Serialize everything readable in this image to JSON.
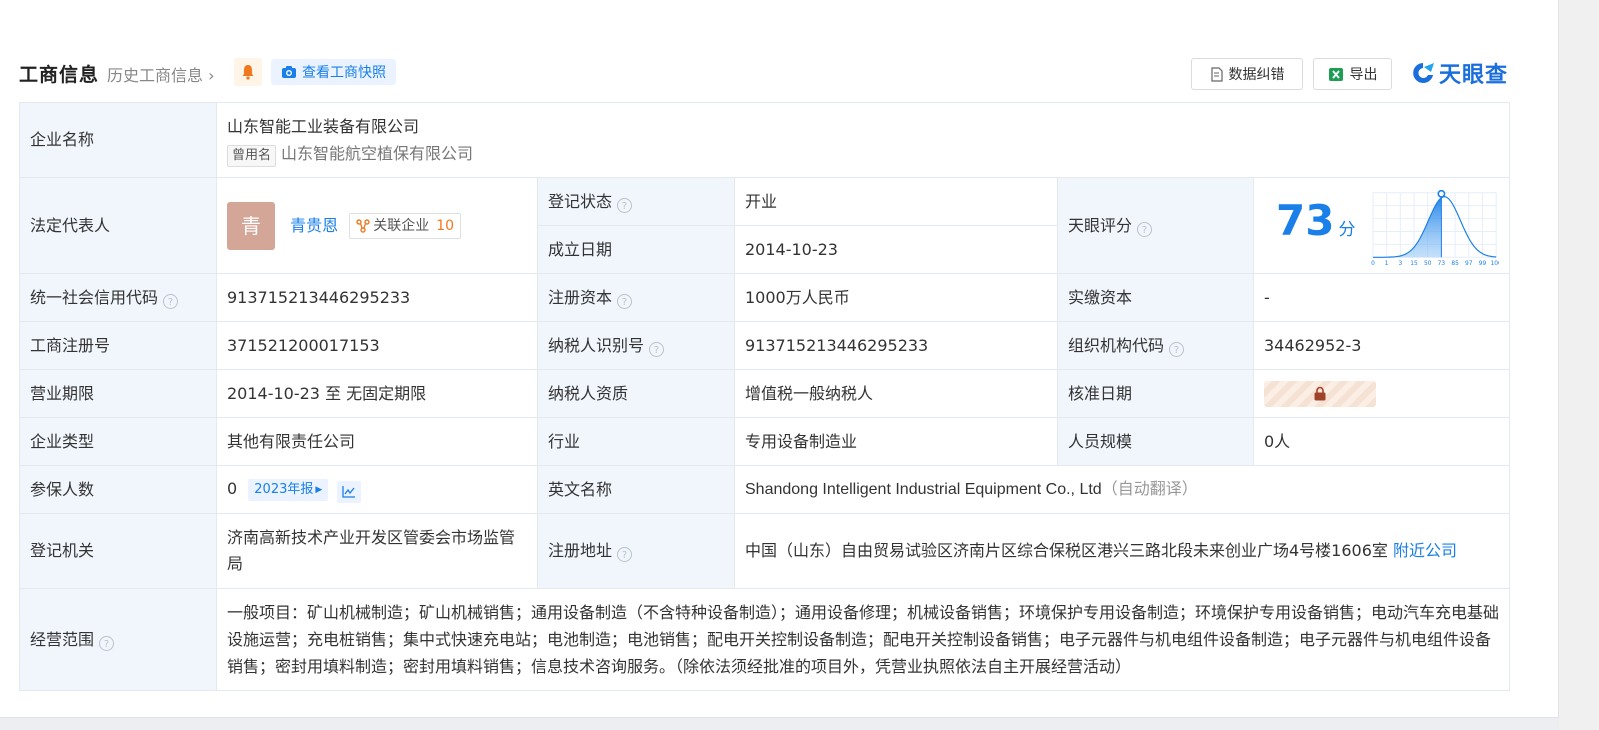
{
  "header": {
    "title": "工商信息",
    "history_link": "历史工商信息",
    "snapshot_button": "查看工商快照",
    "correction_button": "数据纠错",
    "export_button": "导出",
    "logo_text": "天眼查"
  },
  "company": {
    "name_label": "企业名称",
    "name": "山东智能工业装备有限公司",
    "former_name_tag": "曾用名",
    "former_name": "山东智能航空植保有限公司",
    "legal_rep_label": "法定代表人",
    "legal_rep_avatar": "青",
    "legal_rep_name": "青贵恩",
    "related_label": "关联企业",
    "related_count": "10",
    "reg_status_label": "登记状态",
    "reg_status": "开业",
    "founded_label": "成立日期",
    "founded": "2014-10-23",
    "score_label": "天眼评分",
    "score": "73",
    "score_unit": "分",
    "credit_code_label": "统一社会信用代码",
    "credit_code": "913715213446295233",
    "reg_capital_label": "注册资本",
    "reg_capital": "1000万人民币",
    "paid_capital_label": "实缴资本",
    "paid_capital": "-",
    "biz_reg_no_label": "工商注册号",
    "biz_reg_no": "371521200017153",
    "taxpayer_id_label": "纳税人识别号",
    "taxpayer_id": "913715213446295233",
    "org_code_label": "组织机构代码",
    "org_code": "34462952-3",
    "term_label": "营业期限",
    "term": "2014-10-23 至 无固定期限",
    "taxpayer_qual_label": "纳税人资质",
    "taxpayer_qual": "增值税一般纳税人",
    "approval_date_label": "核准日期",
    "type_label": "企业类型",
    "type": "其他有限责任公司",
    "industry_label": "行业",
    "industry": "专用设备制造业",
    "staff_label": "人员规模",
    "staff": "0人",
    "insured_label": "参保人数",
    "insured": "0",
    "report_tag": "2023年报",
    "english_name_label": "英文名称",
    "english_name": "Shandong Intelligent Industrial Equipment Co., Ltd",
    "english_note": "（自动翻译）",
    "authority_label": "登记机关",
    "authority": "济南高新技术产业开发区管委会市场监管局",
    "address_label": "注册地址",
    "address": "中国（山东）自由贸易试验区济南片区综合保税区港兴三路北段未来创业广场4号楼1606室",
    "nearby_link": "附近公司",
    "scope_label": "经营范围",
    "scope": "一般项目：矿山机械制造；矿山机械销售；通用设备制造（不含特种设备制造）；通用设备修理；机械设备销售；环境保护专用设备制造；环境保护专用设备销售；电动汽车充电基础设施运营；充电桩销售；集中式快速充电站；电池制造；电池销售；配电开关控制设备制造；配电开关控制设备销售；电子元器件与机电组件设备制造；电子元器件与机电组件设备销售；密封用填料制造；密封用填料销售；信息技术咨询服务。（除依法须经批准的项目外，凭营业执照依法自主开展经营活动）"
  },
  "score_chart": {
    "type": "area",
    "x_ticks": [
      "0",
      "1",
      "3",
      "15",
      "50",
      "73",
      "85",
      "97",
      "99",
      "100"
    ],
    "marker_value": "73"
  },
  "colors": {
    "accent": "#1a7fe8",
    "status_green": "#1ea26a",
    "label_bg": "#f1f6fd",
    "border": "#e4e8ef",
    "avatar": "#d4a698"
  }
}
